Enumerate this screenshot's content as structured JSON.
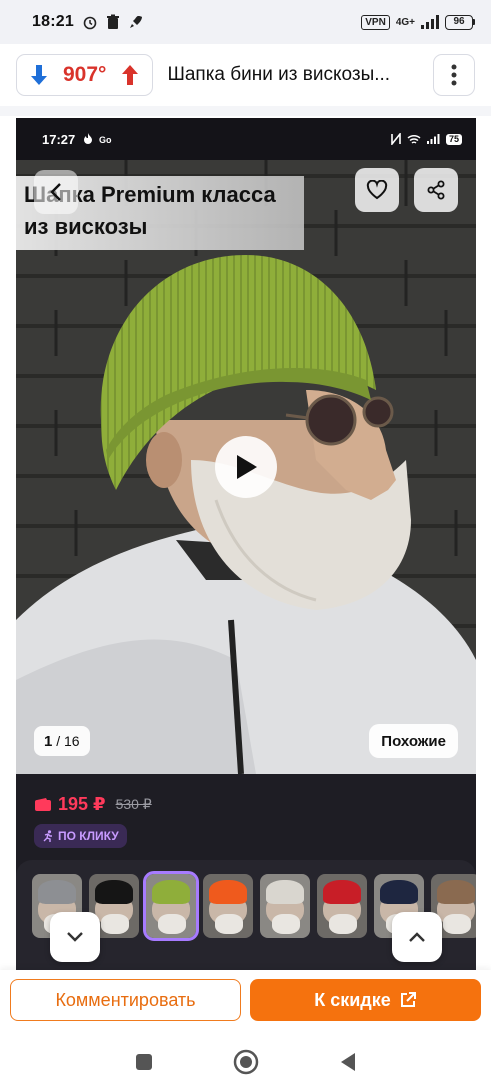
{
  "status_bar": {
    "time": "18:21",
    "vpn": "VPN",
    "network": "4G+",
    "battery": "96"
  },
  "header": {
    "temperature": "907°",
    "title": "Шапка бини из вискозы..."
  },
  "screenshot": {
    "status": {
      "time": "17:27",
      "battery": "75"
    },
    "banner_line1": "Шапка Premium класса",
    "banner_line2": "из вискозы",
    "counter_current": "1",
    "counter_total": "/ 16",
    "similar_label": "Похожие",
    "price_new": "195 ₽",
    "price_old": "530 ₽",
    "click_badge": "ПО КЛИКУ",
    "thumbnails": [
      {
        "hat": "#8d8f93"
      },
      {
        "hat": "#151515"
      },
      {
        "hat": "#8fae3a",
        "selected": true
      },
      {
        "hat": "#ef5a1d"
      },
      {
        "hat": "#d9d6cf"
      },
      {
        "hat": "#c81e27"
      },
      {
        "hat": "#1e2640"
      },
      {
        "hat": "#8a6a50"
      }
    ]
  },
  "actions": {
    "comment_label": "Комментировать",
    "deal_label": "К скидке"
  },
  "colors": {
    "accent": "#f5720e",
    "temperature_red": "#d9332b",
    "temperature_blue": "#1f6fd8",
    "price_pink": "#ff3a5b"
  }
}
